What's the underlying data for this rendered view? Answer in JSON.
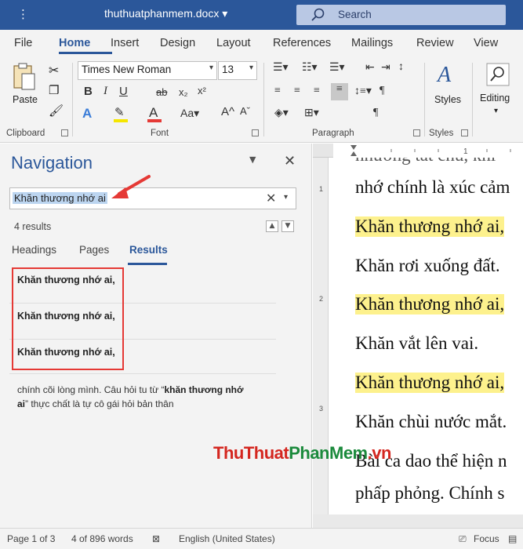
{
  "titlebar": {
    "menu": "⋮",
    "doc_title": "thuthuatphanmem.docx ▾",
    "search_label": "Search"
  },
  "ribbon_tabs": [
    "File",
    "Home",
    "Insert",
    "Design",
    "Layout",
    "References",
    "Mailings",
    "Review",
    "View"
  ],
  "ribbon": {
    "paste": "Paste",
    "font_name": "Times New Roman",
    "font_size": "13",
    "styles": "Styles",
    "editing": "Editing",
    "groups": {
      "clipboard": "Clipboard",
      "font": "Font",
      "paragraph": "Paragraph",
      "styles": "Styles"
    }
  },
  "navigation": {
    "title": "Navigation",
    "search_value": "Khăn thương nhớ ai",
    "results_count": "4 results",
    "tabs": [
      "Headings",
      "Pages",
      "Results"
    ],
    "results": [
      "Khăn thương nhớ ai,",
      "Khăn thương nhớ ai,",
      "Khăn thương nhớ ai,"
    ],
    "snippet_pre": "chính cõi lòng mình. Câu hỏi tu từ “",
    "snippet_bold1": "khăn thương nhớ",
    "snippet_bold2": "ai",
    "snippet_post": "” thực chất là tự cô gái hỏi bản thân"
  },
  "document": {
    "lines": [
      "nhớ chính là xúc cảm",
      "Khăn thương nhớ ai,",
      "Khăn rơi xuống đất.",
      "Khăn thương nhớ ai,",
      "Khăn vắt lên vai.",
      "Khăn thương nhớ ai,",
      "Khăn chùi nước mắt.",
      "Bài ca dao thể hiện n",
      "phấp phỏng. Chính s"
    ],
    "ruler_v": [
      "1",
      "2",
      "3"
    ]
  },
  "watermark": {
    "part1": "ThuThuat",
    "part2": "PhanMem",
    "part3": ".vn"
  },
  "statusbar": {
    "page": "Page 1 of 3",
    "words": "4 of 896 words",
    "language": "English (United States)",
    "focus": "Focus"
  },
  "colors": {
    "accent": "#2b579a",
    "highlight": "#fdf18d",
    "annotation": "#e53935"
  }
}
